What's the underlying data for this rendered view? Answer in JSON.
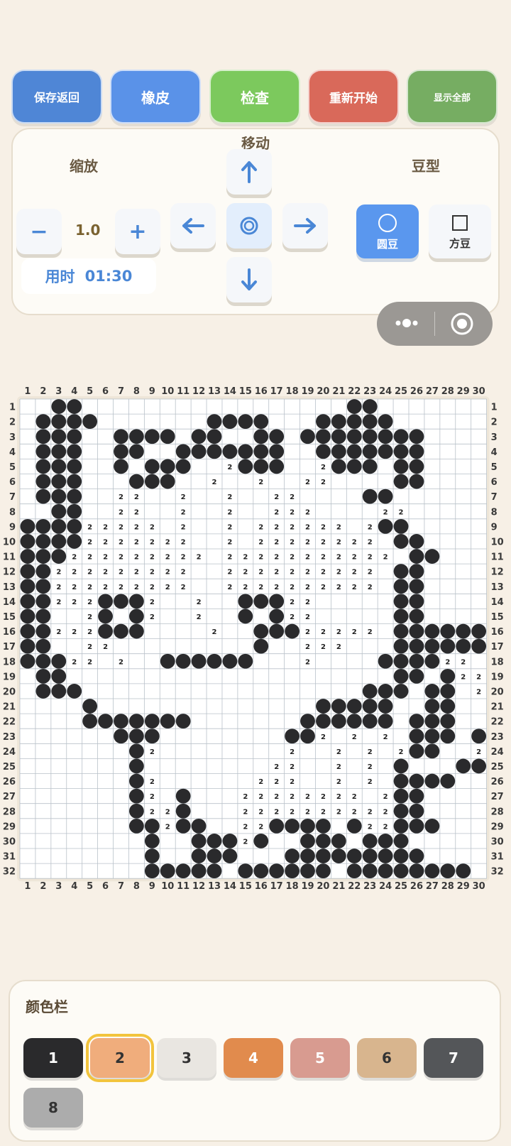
{
  "toolbar": {
    "save_return": "保存返回",
    "eraser": "橡皮",
    "check": "检查",
    "restart": "重新开始",
    "show_all": "显示全部",
    "colors": {
      "save": "#4f86d6",
      "eraser": "#5a92e8",
      "check": "#7cc95d",
      "restart": "#d9695a",
      "show_all": "#76ad62"
    }
  },
  "controls": {
    "zoom_label": "缩放",
    "move_label": "移动",
    "bead_type_label": "豆型",
    "zoom_minus": "−",
    "zoom_plus": "+",
    "zoom_value": "1.0",
    "timer_label": "用时",
    "timer_value": "01:30",
    "up_icon": "arrow-up-icon",
    "down_icon": "arrow-down-icon",
    "left_icon": "arrow-left-icon",
    "right_icon": "arrow-right-icon",
    "center_icon": "target-icon",
    "round_bead": {
      "label": "圆豆",
      "icon": "circle-icon",
      "selected": true
    },
    "square_bead": {
      "label": "方豆",
      "icon": "square-icon",
      "selected": false
    }
  },
  "capsule": {
    "menu_icon": "more-dots-icon",
    "close_icon": "target-icon"
  },
  "board": {
    "columns": [
      1,
      2,
      3,
      4,
      5,
      6,
      7,
      8,
      9,
      10,
      11,
      12,
      13,
      14,
      15,
      16,
      17,
      18,
      19,
      20,
      21,
      22,
      23,
      24,
      25,
      26,
      27,
      28,
      29,
      30
    ],
    "rows": [
      1,
      2,
      3,
      4,
      5,
      6,
      7,
      8,
      9,
      10,
      11,
      12,
      13,
      14,
      15,
      16,
      17,
      18,
      19,
      20,
      21,
      22,
      23,
      24,
      25,
      26,
      27,
      28,
      29,
      30,
      31,
      32
    ],
    "bead_color": "#2a2a2c",
    "cells": [
      "..##.................##.......",
      ".####.......####...#####......",
      ".###..####.##..##.########....",
      ".###..##..#######..#######....",
      ".###..#.###..2###..2###.##....",
      ".###...###..2..2..22....##....",
      ".###..22..2..2..22....##......",
      "..##..22..2..2..222....22.....",
      "####22222.2..2.222222.2##.....",
      "####2222222..2.22222222.##....",
      "###222222222.22222222222.##...",
      "##222222222..2222222222.##....",
      "##222222222..2222222222.##....",
      "##222###2..2..###22.....##....",
      "##..2#.#2..2..#.#22.....##....",
      "##222###....2..###22222.#######",
      "##..22.........#..222...#######",
      "###22.2..######...2....####22..",
      ".##.....................##.#222",
      ".###..................###.##.22",
      "....#..............#####..##...",
      "....#######.......######.###...",
      "......###........##2.2.2.###.##",
      ".......#2........2..2.2.2##..2#",
      ".......#........22..2.2.#...##.",
      ".......#2......222..2.2.####...",
      ".......#2.#...22222222.2##.....",
      ".......#22#...2222222222##.....",
      ".......##2##..22####.#22###....",
      "........#..###2#..###.###......",
      "........#..###...#########.....",
      "........#####.######.########..."
    ]
  },
  "palette": {
    "title": "颜色栏",
    "items": [
      {
        "label": "1",
        "color": "#2a2a2c",
        "text": "#ffffff",
        "selected": false
      },
      {
        "label": "2",
        "color": "#f0ad7c",
        "text": "#333333",
        "selected": true
      },
      {
        "label": "3",
        "color": "#e9e6e1",
        "text": "#333333",
        "selected": false
      },
      {
        "label": "4",
        "color": "#e18b4d",
        "text": "#ffffff",
        "selected": false
      },
      {
        "label": "5",
        "color": "#d89b90",
        "text": "#ffffff",
        "selected": false
      },
      {
        "label": "6",
        "color": "#d8b58e",
        "text": "#333333",
        "selected": false
      },
      {
        "label": "7",
        "color": "#545659",
        "text": "#ffffff",
        "selected": false
      },
      {
        "label": "8",
        "color": "#acacac",
        "text": "#333333",
        "selected": false
      }
    ]
  }
}
